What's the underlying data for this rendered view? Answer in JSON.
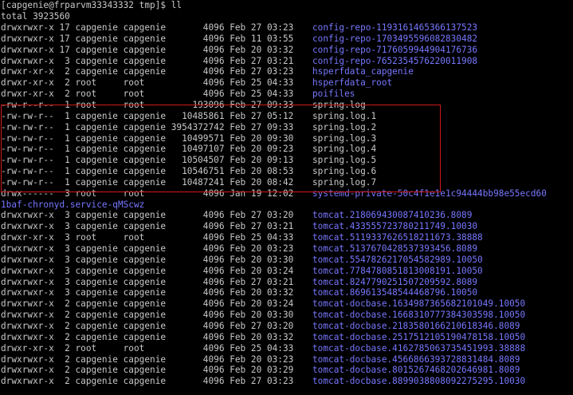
{
  "terminal": {
    "prompt": "[capgenie@frparvm33343332 tmp]$ ll",
    "total": "total 3923560",
    "colors": {
      "background": "#000000",
      "text": "#c8c8c8",
      "directory": "#7777ff",
      "highlight_box": "#d11a1a"
    },
    "rows": [
      {
        "meta": "drwxrwxr-x 17 capgenie capgenie       4096 Feb 27 03:23",
        "name": "config-repo-1193161465366137523",
        "type": "dir"
      },
      {
        "meta": "drwxrwxr-x 17 capgenie capgenie       4096 Feb 11 03:55",
        "name": "config-repo-1703495596082830482",
        "type": "dir"
      },
      {
        "meta": "drwxrwxr-x 17 capgenie capgenie       4096 Feb 20 03:32",
        "name": "config-repo-7176059944904176736",
        "type": "dir"
      },
      {
        "meta": "drwxrwxr-x  3 capgenie capgenie       4096 Feb 27 03:21",
        "name": "config-repo-765235457622001190⁠​8",
        "type": "dir"
      },
      {
        "meta": "drwxr-xr-x  2 capgenie capgenie       4096 Feb 27 03:23",
        "name": "hsperfdata_capgenie",
        "type": "dir"
      },
      {
        "meta": "drwxr-xr-x  2 root     root           4096 Feb 25 04:33",
        "name": "hsperfdata_root",
        "type": "dir"
      },
      {
        "meta": "drwxr-xr-x  2 root     root           4096 Feb 25 04:33",
        "name": "poifiles",
        "type": "dir"
      },
      {
        "meta": "-rw-r--r--  1 root     root         193096 Feb 27 09:33",
        "name": "spring.log",
        "type": "file"
      },
      {
        "meta": "-rw-rw-r--  1 capgenie capgenie   10485861 Feb 27 05:12",
        "name": "spring.log.1",
        "type": "file"
      },
      {
        "meta": "-rw-rw-r--  1 capgenie capgenie 3954372742 Feb 27 09:33",
        "name": "spring.log.2",
        "type": "file"
      },
      {
        "meta": "-rw-rw-r--  1 capgenie capgenie   10499571 Feb 20 09:30",
        "name": "spring.log.3",
        "type": "file"
      },
      {
        "meta": "-rw-rw-r--  1 capgenie capgenie   10497107 Feb 20 09:23",
        "name": "spring.log.4",
        "type": "file"
      },
      {
        "meta": "-rw-rw-r--  1 capgenie capgenie   10504507 Feb 20 09:13",
        "name": "spring.log.5",
        "type": "file"
      },
      {
        "meta": "-rw-rw-r--  1 capgenie capgenie   10546751 Feb 20 08:53",
        "name": "spring.log.6",
        "type": "file"
      },
      {
        "meta": "-rw-rw-r--  1 capgenie capgenie   10487241 Feb 20 08:42",
        "name": "spring.log.7",
        "type": "file"
      },
      {
        "meta": "drwx------  3 root     root           4096 Jan 19 12:02",
        "name": "systemd-private-50c4f1e1e1c94444bb98e55ecd60",
        "type": "dir"
      },
      {
        "meta": "",
        "name": "1baf-chronyd.service-qMScwz",
        "type": "dir",
        "wrap": true
      },
      {
        "meta": "drwxrwxr-x  3 capgenie capgenie       4096 Feb 27 03:20",
        "name": "tomcat.218069430087410236.8089",
        "type": "dir"
      },
      {
        "meta": "drwxrwxr-x  3 capgenie capgenie       4096 Feb 27 03:21",
        "name": "tomcat.433555723780211749.10030",
        "type": "dir"
      },
      {
        "meta": "drwxr-xr-x  3 root     root           4096 Feb 25 04:33",
        "name": "tomcat.5119337626518211673.38888",
        "type": "dir"
      },
      {
        "meta": "drwxrwxr-x  3 capgenie capgenie       4096 Feb 20 03:23",
        "name": "tomcat.5137670428537393456.8089",
        "type": "dir"
      },
      {
        "meta": "drwxrwxr-x  3 capgenie capgenie       4096 Feb 20 03:30",
        "name": "tomcat.5547826217054582989.10050",
        "type": "dir"
      },
      {
        "meta": "drwxrwxr-x  3 capgenie capgenie       4096 Feb 20 03:24",
        "name": "tomcat.7784780851813008191.10050",
        "type": "dir"
      },
      {
        "meta": "drwxrwxr-x  3 capgenie capgenie       4096 Feb 27 03:21",
        "name": "tomcat.8247790251507209592.8089",
        "type": "dir"
      },
      {
        "meta": "drwxrwxr-x  3 capgenie capgenie       4096 Feb 20 03:32",
        "name": "tomcat.869613548544468796.10050",
        "type": "dir"
      },
      {
        "meta": "drwxrwxr-x  2 capgenie capgenie       4096 Feb 20 03:24",
        "name": "tomcat-docbase.1634987365682101049.10050",
        "type": "dir"
      },
      {
        "meta": "drwxrwxr-x  2 capgenie capgenie       4096 Feb 20 03:30",
        "name": "tomcat-docbase.1668310777384303598.10050",
        "type": "dir"
      },
      {
        "meta": "drwxrwxr-x  2 capgenie capgenie       4096 Feb 27 03:20",
        "name": "tomcat-docbase.2183580166210618346.8089",
        "type": "dir"
      },
      {
        "meta": "drwxrwxr-x  2 capgenie capgenie       4096 Feb 20 03:32",
        "name": "tomcat-docbase.2517512105190478158.10050",
        "type": "dir"
      },
      {
        "meta": "drwxr-xr-x  2 root     root           4096 Feb 25 04:33",
        "name": "tomcat-docbase.4162785063735451993.38888",
        "type": "dir"
      },
      {
        "meta": "drwxrwxr-x  2 capgenie capgenie       4096 Feb 20 03:23",
        "name": "tomcat-docbase.4566866393728831484.8089",
        "type": "dir"
      },
      {
        "meta": "drwxrwxr-x  2 capgenie capgenie       4096 Feb 20 03:29",
        "name": "tomcat-docbase.8015267468202646981.8089",
        "type": "dir"
      },
      {
        "meta": "drwxrwxr-x  2 capgenie capgenie       4096 Feb 27 03:23",
        "name": "tomcat-docbase.8899038808092275295.10030",
        "type": "dir"
      }
    ]
  }
}
